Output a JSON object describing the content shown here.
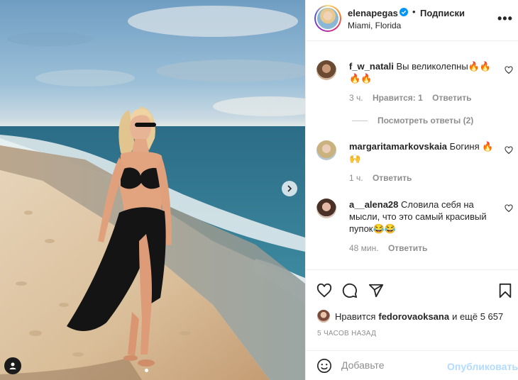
{
  "post": {
    "username": "elenapegas",
    "follow_label": "Подписки",
    "location": "Miami, Florida",
    "more_label": "•••",
    "separator": "•"
  },
  "comments": [
    {
      "username": "f_w_natali",
      "text": "Вы великолепны🔥🔥🔥🔥",
      "time": "3 ч.",
      "likes": "Нравится: 1",
      "reply": "Ответить",
      "view_replies": "Посмотреть ответы (2)"
    },
    {
      "username": "margaritamarkovskaia",
      "text": "Богиня 🔥🙌",
      "time": "1 ч.",
      "reply": "Ответить"
    },
    {
      "username": "a__alena28",
      "text": "Словила себя на мысли, что это самый красивый пупок😂😂",
      "time": "48 мин.",
      "reply": "Ответить"
    }
  ],
  "likes": {
    "prefix": "Нравится",
    "user": "fedorovaoksana",
    "suffix": "и ещё 5 657"
  },
  "time_ago": "5 ЧАСОВ НАЗАД",
  "comment_box": {
    "placeholder": "Добавьте",
    "publish_label": "Опубликовать"
  },
  "colors": {
    "accent": "#0095f6",
    "publish_disabled": "#b3dbff",
    "verified": "#0095f6",
    "muted": "#8e8e8e"
  },
  "icons": {
    "heart": "heart-icon",
    "comment": "comment-icon",
    "share": "paper-plane-icon",
    "save": "bookmark-icon",
    "emoji": "smiley-icon",
    "next": "chevron-right-icon",
    "tag": "user-tag-icon"
  }
}
